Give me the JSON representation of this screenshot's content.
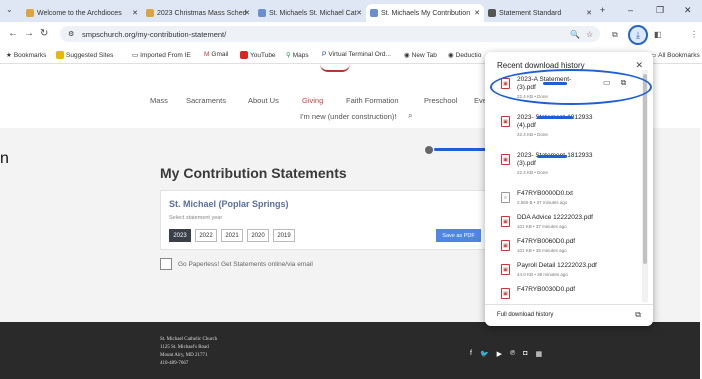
{
  "tabs": [
    {
      "title": "Welcome to the Archdioces",
      "color": "#d9a441"
    },
    {
      "title": "2023 Christmas Mass Sched",
      "color": "#d9a441"
    },
    {
      "title": "St. Michaels St. Michael Cat",
      "color": "#6a8fd0"
    },
    {
      "title": "St. Michaels My Contribution",
      "color": "#6a8fd0"
    },
    {
      "title": "Statement Standard",
      "color": "#555555"
    }
  ],
  "address": "smpschurch.org/my-contribution-statement/",
  "bookmarks": [
    "Bookmarks",
    "Suggested Sites",
    "Imported From IE",
    "Gmail",
    "YouTube",
    "Maps",
    "Virtual Terminal Ord...",
    "New Tab",
    "Deductio"
  ],
  "all_bookmarks": "All Bookmarks",
  "site_nav": {
    "items": [
      "Mass",
      "Sacraments",
      "About Us",
      "Giving",
      "Faith Formation",
      "Preschool",
      "Eve"
    ],
    "second_row": "I'm new (under construction)!"
  },
  "page_title": "My Contribution Statements",
  "parish": "St. Michael (Poplar Springs)",
  "select_label": "Select statement year",
  "years": [
    "2023",
    "2022",
    "2021",
    "2020",
    "2019"
  ],
  "save_pdf": "Save as PDF",
  "paperless": "Go Paperless! Get Statements online/via email",
  "footer": [
    "St. Michael Catholic Church",
    "1125 St. Michael's Road",
    "Mount Airy, MD 21771",
    "410-489-7667"
  ],
  "left_fragment": "n",
  "downloads": {
    "title": "Recent download history",
    "items": [
      {
        "name": "2023-A      Statement-",
        "name2": "(3).pdf",
        "meta": "22.4 KB • Done",
        "type": "pdf"
      },
      {
        "name": "2023-          Statement-1812933",
        "name2": "(4).pdf",
        "meta": "22.4 KB • Done",
        "type": "pdf"
      },
      {
        "name": "2023-           Statement-1812933",
        "name2": "(3).pdf",
        "meta": "22.4 KB • Done",
        "type": "pdf"
      },
      {
        "name": "F47RYB0000D0.txt",
        "name2": "",
        "meta": "2,560 B • 37 minutes ago",
        "type": "txt"
      },
      {
        "name": "DDA Advice 12222023.pdf",
        "name2": "",
        "meta": "101 KB • 37 minutes ago",
        "type": "pdf"
      },
      {
        "name": "F47RYB0060D0.pdf",
        "name2": "",
        "meta": "101 KB • 38 minutes ago",
        "type": "pdf"
      },
      {
        "name": "Payroll Detail 12222023.pdf",
        "name2": "",
        "meta": "44.0 KB • 38 minutes ago",
        "type": "pdf"
      },
      {
        "name": "F47RYB0030D0.pdf",
        "name2": "",
        "meta": "",
        "type": "pdf"
      }
    ],
    "full_history": "Full download history"
  }
}
